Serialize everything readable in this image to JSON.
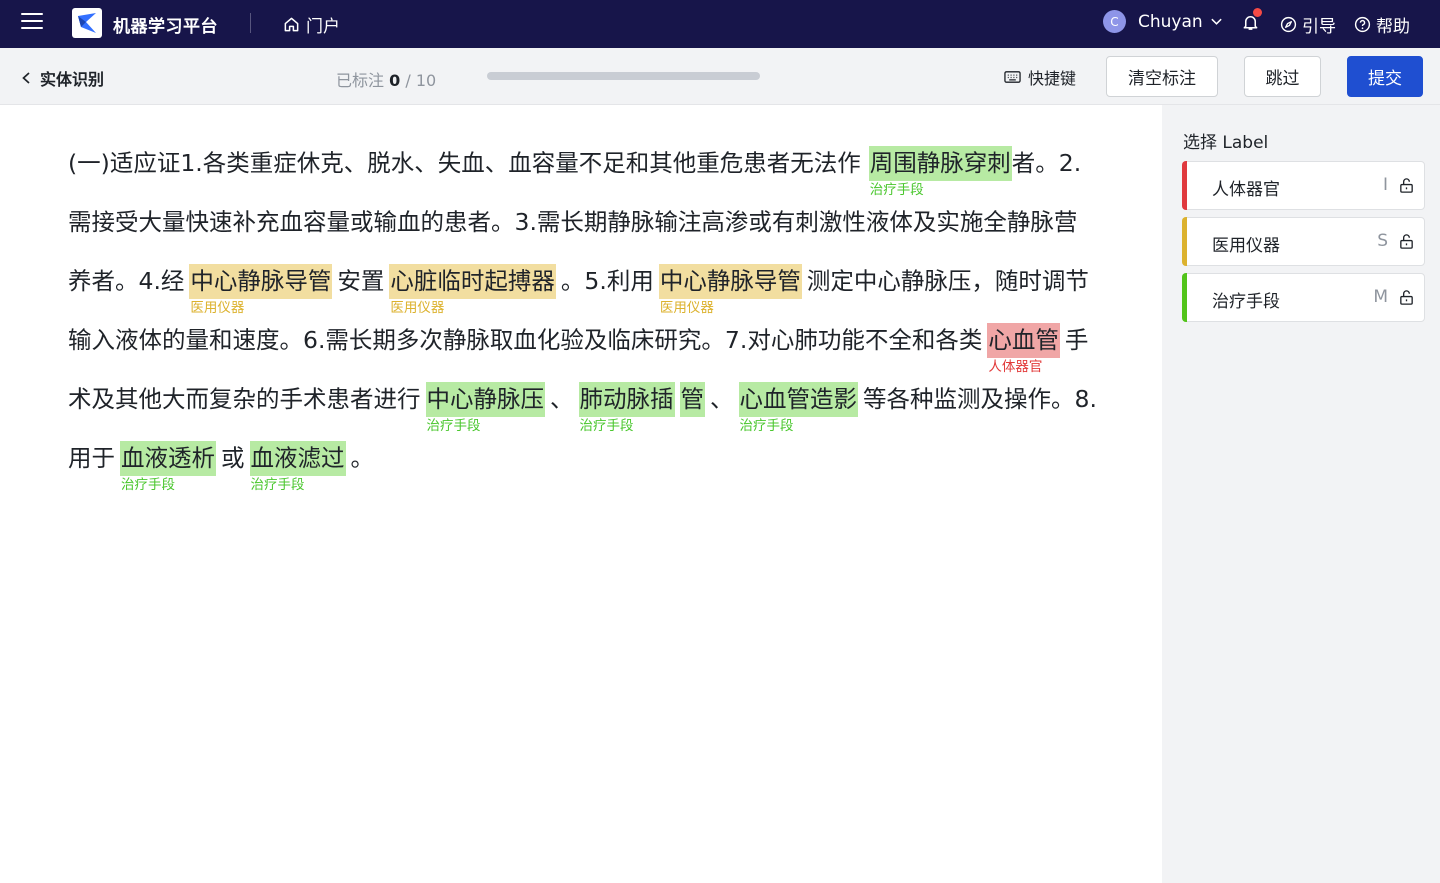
{
  "topnav": {
    "app_title": "机器学习平台",
    "portal_label": "门户",
    "user_initial": "C",
    "user_name": "Chuyan",
    "guide_label": "引导",
    "help_label": "帮助"
  },
  "subbar": {
    "back_title": "实体识别",
    "progress_prefix": "已标注",
    "progress_done": "0",
    "progress_total": "/ 10",
    "progress_fraction": 0,
    "shortcut_label": "快捷键",
    "clear_label": "清空标注",
    "skip_label": "跳过",
    "submit_label": "提交"
  },
  "document": {
    "t1": "(一)适应证1.各类重症休克、脱水、失血、血容量不足和其他重危患者无法作",
    "e1": {
      "text": "周围静脉穿刺",
      "label": "治疗手段"
    },
    "t2": "者。2.需接受大量快速补充血容量或输血的患者。3.需长期静脉输注高渗或有刺激性液体及实施全静脉营养者。4.经",
    "e2": {
      "text": "中心静脉导管",
      "label": "医用仪器"
    },
    "t3": "安置",
    "e3": {
      "text": "心脏临时起搏器",
      "label": "医用仪器"
    },
    "t4": "。5.利用",
    "e4": {
      "text": "中心静脉导管",
      "label": "医用仪器"
    },
    "t5": "测定中心静脉压，随时调节输入液体的量和速度。6.需长期多次静脉取血化验及临床研究。7.对心肺功能不全和各类",
    "e5": {
      "text": "心血管",
      "label": "人体器官"
    },
    "t6": "手术及其他大而复杂的手术患者进行",
    "e6": {
      "text": "中心静脉压",
      "label": "治疗手段"
    },
    "t7": "、",
    "e7a": {
      "text": "肺动脉插",
      "label": "治疗手段"
    },
    "e7b": {
      "text": "管"
    },
    "t8": "、",
    "e8": {
      "text": "心血管造影",
      "label": "治疗手段"
    },
    "t9": "等各种监测及操作。8.用于",
    "e9": {
      "text": "血液透析",
      "label": "治疗手段"
    },
    "t10": "或",
    "e10": {
      "text": "血液滤过",
      "label": "治疗手段"
    },
    "t11": "。"
  },
  "sidebar": {
    "title": "选择 Label",
    "labels": [
      {
        "name": "人体器官",
        "key": "I",
        "color": "#e0393e"
      },
      {
        "name": "医用仪器",
        "key": "S",
        "color": "#dcb22e"
      },
      {
        "name": "治疗手段",
        "key": "M",
        "color": "#52c41a"
      }
    ]
  }
}
